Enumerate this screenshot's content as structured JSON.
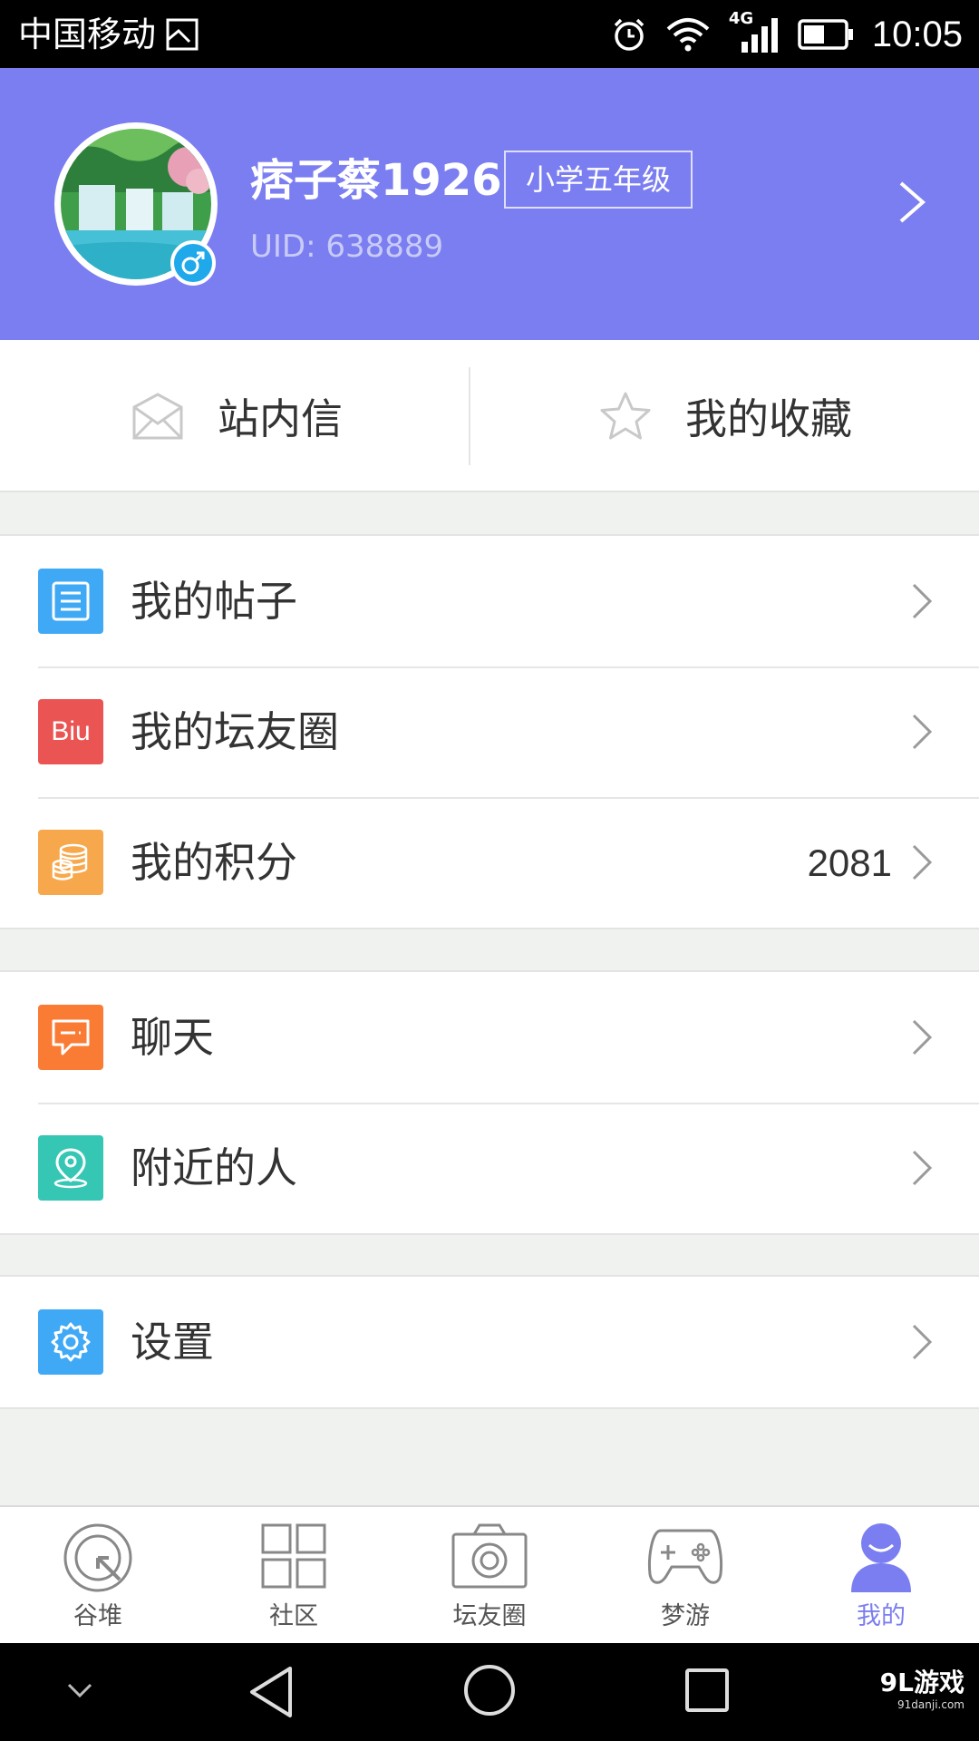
{
  "status_bar": {
    "carrier": "中国移动",
    "network": "4G",
    "time": "10:05"
  },
  "profile": {
    "username": "痞子蔡1926",
    "grade": "小学五年级",
    "uid": "UID: 638889",
    "gender": "male"
  },
  "quick_actions": [
    {
      "label": "站内信",
      "icon": "envelope-icon"
    },
    {
      "label": "我的收藏",
      "icon": "star-icon"
    }
  ],
  "menu_groups": [
    {
      "items": [
        {
          "label": "我的帖子",
          "icon": "document-icon",
          "icon_color": "#3fa9f5"
        },
        {
          "label": "我的坛友圈",
          "icon": "biu-icon",
          "icon_text": "Biu",
          "icon_color": "#ea5554"
        },
        {
          "label": "我的积分",
          "icon": "coins-icon",
          "icon_color": "#f7a84c",
          "value": "2081"
        }
      ]
    },
    {
      "items": [
        {
          "label": "聊天",
          "icon": "chat-icon",
          "icon_color": "#fa7b34"
        },
        {
          "label": "附近的人",
          "icon": "location-icon",
          "icon_color": "#35c6b4"
        }
      ]
    },
    {
      "items": [
        {
          "label": "设置",
          "icon": "gear-icon",
          "icon_color": "#3fa9f5"
        }
      ]
    }
  ],
  "tab_bar": {
    "tabs": [
      {
        "label": "谷堆",
        "icon": "target-icon"
      },
      {
        "label": "社区",
        "icon": "grid-icon"
      },
      {
        "label": "坛友圈",
        "icon": "camera-icon"
      },
      {
        "label": "梦游",
        "icon": "gamepad-icon"
      },
      {
        "label": "我的",
        "icon": "person-icon"
      }
    ],
    "active_index": 4
  },
  "watermark": {
    "main": "9L游戏",
    "sub": "91danji.com"
  },
  "colors": {
    "accent": "#7b7ef0",
    "background": "#f0f2ef"
  }
}
